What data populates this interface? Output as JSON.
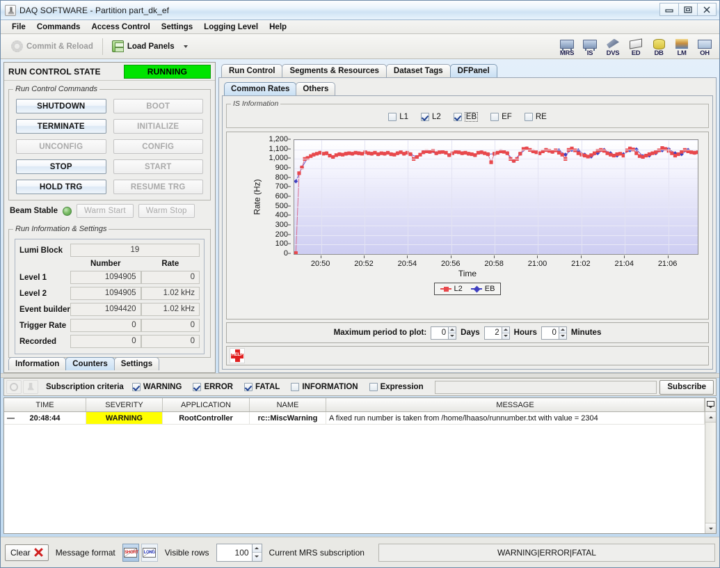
{
  "window": {
    "title": "DAQ SOFTWARE - Partition part_dk_ef",
    "icon": "java-cup-icon",
    "minimize": "minimize-icon",
    "maximize": "maximize-icon",
    "close": "close-icon"
  },
  "menubar": {
    "items": [
      "File",
      "Commands",
      "Access Control",
      "Settings",
      "Logging Level",
      "Help"
    ]
  },
  "toolbar": {
    "commit_reload": "Commit & Reload",
    "load_panels": "Load Panels",
    "icons": [
      {
        "label": "MRS",
        "name": "mrs-icon"
      },
      {
        "label": "IS",
        "name": "is-icon"
      },
      {
        "label": "DVS",
        "name": "dvs-icon"
      },
      {
        "label": "ED",
        "name": "ed-icon"
      },
      {
        "label": "DB",
        "name": "db-icon"
      },
      {
        "label": "LM",
        "name": "lm-icon"
      },
      {
        "label": "OH",
        "name": "oh-icon"
      }
    ]
  },
  "run_control": {
    "state_label": "RUN CONTROL STATE",
    "state_value": "RUNNING",
    "state_color": "#00e400",
    "commands_legend": "Run Control Commands",
    "buttons": [
      {
        "label": "SHUTDOWN",
        "enabled": true
      },
      {
        "label": "BOOT",
        "enabled": false
      },
      {
        "label": "TERMINATE",
        "enabled": true
      },
      {
        "label": "INITIALIZE",
        "enabled": false
      },
      {
        "label": "UNCONFIG",
        "enabled": false
      },
      {
        "label": "CONFIG",
        "enabled": false
      },
      {
        "label": "STOP",
        "enabled": true
      },
      {
        "label": "START",
        "enabled": false
      },
      {
        "label": "HOLD TRG",
        "enabled": true
      },
      {
        "label": "RESUME TRG",
        "enabled": false
      }
    ],
    "beam_stable_label": "Beam Stable",
    "beam_led_color": "#7fc06a",
    "warm_start": "Warm Start",
    "warm_stop": "Warm Stop"
  },
  "run_info": {
    "legend": "Run Information & Settings",
    "lumi_block_label": "Lumi Block",
    "lumi_block_value": "19",
    "col_number": "Number",
    "col_rate": "Rate",
    "rows": [
      {
        "label": "Level 1",
        "number": "1094905",
        "rate": "0"
      },
      {
        "label": "Level 2",
        "number": "1094905",
        "rate": "1.02 kHz"
      },
      {
        "label": "Event builder",
        "number": "1094420",
        "rate": "1.02 kHz"
      },
      {
        "label": "Trigger Rate",
        "number": "0",
        "rate": "0"
      },
      {
        "label": "Recorded",
        "number": "0",
        "rate": "0"
      }
    ],
    "tabs": [
      {
        "label": "Information",
        "selected": false
      },
      {
        "label": "Counters",
        "selected": true
      },
      {
        "label": "Settings",
        "selected": false
      }
    ]
  },
  "right_panel": {
    "outer_tabs": [
      {
        "label": "Run Control",
        "selected": false
      },
      {
        "label": "Segments & Resources",
        "selected": false
      },
      {
        "label": "Dataset Tags",
        "selected": false
      },
      {
        "label": "DFPanel",
        "selected": true
      }
    ],
    "inner_tabs": [
      {
        "label": "Common Rates",
        "selected": true
      },
      {
        "label": "Others",
        "selected": false
      }
    ],
    "is_info_legend": "IS Information",
    "checkboxes": [
      {
        "label": "L1",
        "checked": false,
        "focused": false
      },
      {
        "label": "L2",
        "checked": true,
        "focused": false
      },
      {
        "label": "EB",
        "checked": true,
        "focused": true
      },
      {
        "label": "EF",
        "checked": false,
        "focused": false
      },
      {
        "label": "RE",
        "checked": false,
        "focused": false
      }
    ],
    "period": {
      "label": "Maximum period to plot:",
      "days": "0",
      "days_unit": "Days",
      "hours": "2",
      "hours_unit": "Hours",
      "minutes": "0",
      "minutes_unit": "Minutes"
    },
    "help_icon": "help-icon",
    "help_icon_text": "HELP"
  },
  "chart_data": {
    "type": "line",
    "title": "",
    "xlabel": "Time",
    "ylabel": "Rate (Hz)",
    "ylim": [
      0,
      1200
    ],
    "ytick_values": [
      0,
      100,
      200,
      300,
      400,
      500,
      600,
      700,
      800,
      900,
      1000,
      1100,
      1200
    ],
    "ytick_labels": [
      "0",
      "100",
      "200",
      "300",
      "400",
      "500",
      "600",
      "700",
      "800",
      "900",
      "1,000",
      "1,100",
      "1,200"
    ],
    "xtick_labels": [
      "20:50",
      "20:52",
      "20:54",
      "20:56",
      "20:58",
      "21:00",
      "21:02",
      "21:04",
      "21:06"
    ],
    "xlim_labels": [
      "20:49:00",
      "21:07:00"
    ],
    "grid": true,
    "legend_position": "bottom",
    "series": [
      {
        "name": "L2",
        "color": "#e8484c",
        "marker": "square",
        "x": [
          0.4,
          1.2,
          1.9,
          2.6,
          3.3,
          4.1,
          4.8,
          5.6,
          6.4,
          7.2,
          8.0,
          8.8,
          9.6,
          10.4,
          11.2,
          12.0,
          12.8,
          13.6,
          14.4,
          15.2,
          16.0,
          16.8,
          17.6,
          18.4,
          19.2,
          20.0,
          20.8,
          21.6,
          22.4,
          23.2,
          24.0,
          24.8,
          25.6,
          26.4,
          27.2,
          28.0,
          28.8,
          29.6,
          30.4,
          31.2,
          32.0,
          32.8,
          33.6,
          34.4,
          35.2,
          36.0,
          36.8,
          37.6,
          38.4,
          39.2,
          40.0,
          40.8,
          41.6,
          42.4,
          43.2,
          44.0,
          44.8,
          45.6,
          46.4,
          47.2,
          48.0,
          48.8,
          49.6,
          50.4,
          51.2,
          52.0,
          52.8,
          53.6,
          54.4,
          55.2,
          56.0,
          56.8,
          57.6,
          58.4,
          59.2,
          60.0,
          60.8,
          61.6,
          62.4,
          63.2,
          64.0,
          64.8,
          65.6,
          66.4,
          67.2,
          68.0,
          68.8,
          69.6,
          70.4,
          71.2,
          72.0,
          72.8,
          73.6,
          74.4,
          75.2,
          76.0,
          76.8,
          77.6,
          78.4,
          79.2,
          80.0,
          80.8,
          81.6,
          82.4,
          83.2,
          84.0,
          84.8,
          85.6,
          86.4,
          87.2,
          88.0,
          88.8,
          89.6,
          90.4,
          91.2,
          92.0,
          92.8,
          93.6,
          94.4,
          95.2,
          96.0,
          96.8,
          97.6,
          98.4,
          99.2,
          100.0
        ],
        "y": [
          10,
          850,
          910,
          1000,
          1010,
          1030,
          1045,
          1055,
          1065,
          1055,
          1060,
          1035,
          1020,
          1040,
          1050,
          1045,
          1055,
          1060,
          1055,
          1065,
          1060,
          1055,
          1070,
          1060,
          1055,
          1065,
          1050,
          1060,
          1055,
          1065,
          1050,
          1045,
          1060,
          1070,
          1055,
          1065,
          1050,
          1000,
          1020,
          1045,
          1070,
          1080,
          1075,
          1085,
          1060,
          1070,
          1075,
          1065,
          1040,
          1060,
          1075,
          1070,
          1060,
          1065,
          1055,
          1050,
          1040,
          1065,
          1070,
          1060,
          1050,
          965,
          1055,
          1065,
          1080,
          1075,
          1060,
          1000,
          980,
          1000,
          1055,
          1105,
          1110,
          1095,
          1080,
          1070,
          1060,
          1080,
          1095,
          1085,
          1075,
          1090,
          1065,
          1045,
          1000,
          1095,
          1110,
          1090,
          1060,
          1045,
          1035,
          1025,
          1040,
          1060,
          1085,
          1095,
          1085,
          1060,
          1045,
          1035,
          1050,
          1055,
          1035,
          1090,
          1110,
          1100,
          1060,
          1030,
          1020,
          1035,
          1050,
          1060,
          1070,
          1090,
          1115,
          1105,
          1085,
          1060,
          1035,
          1050,
          1075,
          1095,
          1080,
          1070,
          1065,
          1070
        ]
      },
      {
        "name": "EB",
        "color": "#3f3fc0",
        "marker": "diamond",
        "x": [
          0.4,
          1.9,
          3.3,
          4.8,
          6.4,
          8.0,
          9.6,
          11.2,
          12.8,
          14.4,
          16.0,
          17.6,
          19.2,
          20.8,
          22.4,
          24.0,
          25.6,
          27.2,
          28.8,
          30.4,
          32.0,
          33.6,
          35.2,
          36.8,
          38.4,
          40.0,
          41.6,
          43.2,
          44.8,
          46.4,
          48.0,
          49.6,
          51.2,
          52.8,
          54.4,
          56.0,
          57.6,
          59.2,
          60.8,
          62.4,
          64.0,
          65.6,
          67.2,
          68.8,
          70.4,
          72.0,
          73.6,
          75.2,
          76.8,
          78.4,
          80.0,
          81.6,
          83.2,
          84.8,
          86.4,
          88.0,
          89.6,
          91.2,
          92.8,
          94.4,
          96.0,
          97.6,
          99.2
        ],
        "y": [
          765,
          910,
          1010,
          1045,
          1065,
          1060,
          1020,
          1050,
          1055,
          1055,
          1060,
          1070,
          1055,
          1050,
          1055,
          1050,
          1060,
          1055,
          1050,
          1020,
          1070,
          1075,
          1060,
          1075,
          1040,
          1075,
          1060,
          1055,
          1040,
          1070,
          1050,
          1055,
          1080,
          1060,
          980,
          1055,
          1110,
          1080,
          1060,
          1095,
          1075,
          1090,
          1045,
          1095,
          1090,
          1045,
          1025,
          1060,
          1095,
          1060,
          1035,
          1050,
          1090,
          1100,
          1030,
          1035,
          1060,
          1090,
          1105,
          1060,
          1050,
          1095,
          1065
        ]
      }
    ]
  },
  "log": {
    "filter_refresh_icon": "refresh-icon",
    "filter_pin_icon": "pin-icon",
    "subscription_label": "Subscription criteria",
    "filters": [
      {
        "label": "WARNING",
        "checked": true
      },
      {
        "label": "ERROR",
        "checked": true
      },
      {
        "label": "FATAL",
        "checked": true
      },
      {
        "label": "INFORMATION",
        "checked": false
      },
      {
        "label": "Expression",
        "checked": false
      }
    ],
    "expression_value": "",
    "subscribe_button": "Subscribe",
    "columns": [
      "TIME",
      "SEVERITY",
      "APPLICATION",
      "NAME",
      "MESSAGE"
    ],
    "rows": [
      {
        "time": "20:48:44",
        "severity": "WARNING",
        "severity_color": "#ffff00",
        "application": "RootController",
        "name": "rc::MiscWarning",
        "message": "A fixed run number is taken from /home/lhaaso/runnumber.txt with value = 2304"
      }
    ]
  },
  "bottom_bar": {
    "clear_label": "Clear",
    "clear_icon": "delete-x-icon",
    "message_format_label": "Message format",
    "format_short": "SHORT",
    "format_long": "LONG",
    "visible_rows_label": "Visible rows",
    "visible_rows_value": "100",
    "current_sub_label": "Current MRS subscription",
    "current_sub_value": "WARNING|ERROR|FATAL"
  }
}
